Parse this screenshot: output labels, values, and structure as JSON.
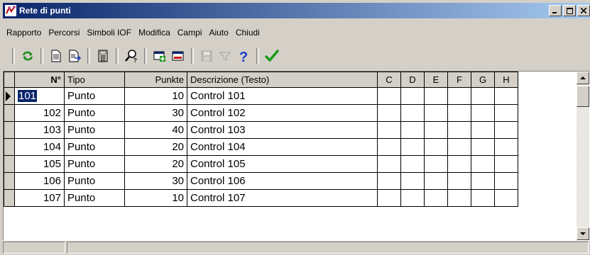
{
  "window": {
    "title": "Rete di punti"
  },
  "menu": [
    {
      "label": "Rapporto"
    },
    {
      "label": "Percorsi"
    },
    {
      "label": "Simboli IOF"
    },
    {
      "label": "Modifica"
    },
    {
      "label": "Campi"
    },
    {
      "label": "Aiuto"
    },
    {
      "label": "Chiudi"
    }
  ],
  "toolbar": {
    "icons": [
      "refresh-icon",
      "document-icon",
      "document-export-icon",
      "calculator-icon",
      "find-icon",
      "add-window-icon",
      "remove-window-icon",
      "save-icon",
      "filter-icon",
      "help-icon",
      "check-icon"
    ]
  },
  "grid": {
    "headers": {
      "n": "N°",
      "tipo": "Tipo",
      "punkte": "Punkte",
      "desc": "Descrizione (Testo)",
      "c": "C",
      "d": "D",
      "e": "E",
      "f": "F",
      "g": "G",
      "h": "H"
    },
    "rows": [
      {
        "n": "101",
        "tipo": "Punto",
        "punkte": "10",
        "desc": "Control 101"
      },
      {
        "n": "102",
        "tipo": "Punto",
        "punkte": "30",
        "desc": "Control 102"
      },
      {
        "n": "103",
        "tipo": "Punto",
        "punkte": "40",
        "desc": "Control 103"
      },
      {
        "n": "104",
        "tipo": "Punto",
        "punkte": "20",
        "desc": "Control 104"
      },
      {
        "n": "105",
        "tipo": "Punto",
        "punkte": "20",
        "desc": "Control 105"
      },
      {
        "n": "106",
        "tipo": "Punto",
        "punkte": "30",
        "desc": "Control 106"
      },
      {
        "n": "107",
        "tipo": "Punto",
        "punkte": "10",
        "desc": "Control 107"
      }
    ]
  }
}
